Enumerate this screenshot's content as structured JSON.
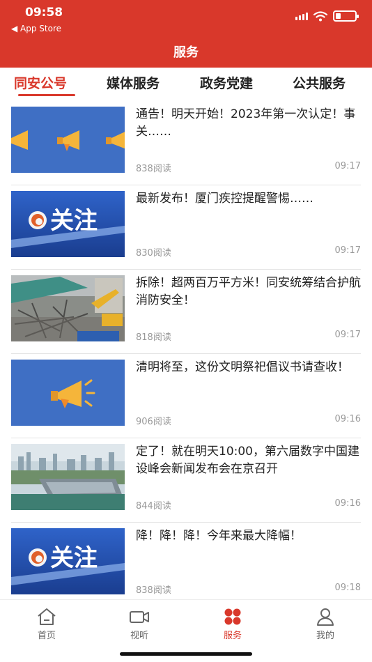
{
  "status_bar": {
    "time": "09:58",
    "back_label": "◀ App Store",
    "battery_level": 0.25
  },
  "header": {
    "title": "服务"
  },
  "tabs": [
    {
      "label": "同安公号",
      "active": true
    },
    {
      "label": "媒体服务",
      "active": false
    },
    {
      "label": "政务党建",
      "active": false
    },
    {
      "label": "公共服务",
      "active": false
    }
  ],
  "articles": [
    {
      "title": "通告！明天开始！2023年第一次认定！事关……",
      "views": "838阅读",
      "time": "09:17",
      "thumb": "megaphones"
    },
    {
      "title": "最新发布！厦门疾控提醒警惕……",
      "views": "830阅读",
      "time": "09:17",
      "thumb": "guanzhu",
      "thumb_text": "关注"
    },
    {
      "title": "拆除！超两百万平方米！同安统筹结合护航消防安全！",
      "views": "818阅读",
      "time": "09:17",
      "thumb": "demolition"
    },
    {
      "title": "清明将至，这份文明祭祀倡议书请查收！",
      "views": "906阅读",
      "time": "09:16",
      "thumb": "megaphone"
    },
    {
      "title": "定了！就在明天10:00，第六届数字中国建设峰会新闻发布会在京召开",
      "views": "844阅读",
      "time": "09:16",
      "thumb": "city"
    },
    {
      "title": "降！降！降！今年来最大降幅！",
      "views": "838阅读",
      "time": "09:18",
      "thumb": "guanzhu",
      "thumb_text": "关注"
    }
  ],
  "bottom_nav": [
    {
      "label": "首页",
      "icon": "home-icon",
      "active": false
    },
    {
      "label": "视听",
      "icon": "video-icon",
      "active": false
    },
    {
      "label": "服务",
      "icon": "services-icon",
      "active": true
    },
    {
      "label": "我的",
      "icon": "profile-icon",
      "active": false
    }
  ],
  "colors": {
    "brand": "#d9382b",
    "thumb_blue": "#3f6fc4"
  }
}
